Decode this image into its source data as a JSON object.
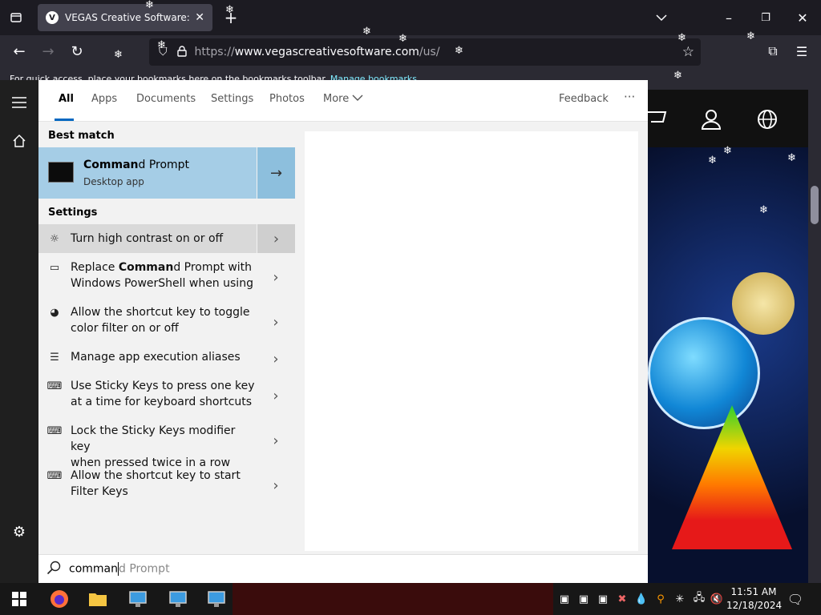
{
  "browser": {
    "tab_title": "VEGAS Creative Software: The c",
    "tab_favicon": "V",
    "url_prefix": "https://",
    "url_host": "www.vegascreativesoftware.com",
    "url_path": "/us/",
    "bookmarks_text": "For quick access, place your bookmarks here on the bookmarks toolbar.",
    "bookmarks_link": "Manage bookmarks…",
    "icons": [
      "tab-list-icon",
      "close-icon",
      "new-tab-icon",
      "list-all-tabs-icon",
      "minimize-icon",
      "restore-icon",
      "back-icon",
      "forward-icon",
      "reload-icon",
      "shield-icon",
      "lock-icon",
      "star-icon",
      "extensions-icon",
      "menu-icon"
    ]
  },
  "search": {
    "filters": [
      {
        "label": "All",
        "active": true
      },
      {
        "label": "Apps"
      },
      {
        "label": "Documents"
      },
      {
        "label": "Settings"
      },
      {
        "label": "Photos"
      },
      {
        "label": "More"
      }
    ],
    "feedback": "Feedback",
    "more_options": "···",
    "best_match_label": "Best match",
    "best_match": {
      "title_bold": "Comman",
      "title_rest": "d Prompt",
      "subtitle": "Desktop app"
    },
    "settings_label": "Settings",
    "settings_results": [
      {
        "icon": "☼",
        "icon_name": "brightness-icon",
        "line1_pre": "Turn high contrast on or off",
        "line1_bold": "",
        "line1_post": "",
        "line2": ""
      },
      {
        "icon": "▭",
        "icon_name": "monitor-icon",
        "line1_pre": "Replace ",
        "line1_bold": "Comman",
        "line1_post": "d Prompt with",
        "line2": "Windows PowerShell when using"
      },
      {
        "icon": "◕",
        "icon_name": "palette-icon",
        "line1_pre": "Allow the shortcut key to toggle",
        "line1_bold": "",
        "line1_post": "",
        "line2": "color filter on or off"
      },
      {
        "icon": "☰",
        "icon_name": "list-icon",
        "line1_pre": "Manage app execution aliases",
        "line1_bold": "",
        "line1_post": "",
        "line2": ""
      },
      {
        "icon": "⌨",
        "icon_name": "keyboard-icon",
        "line1_pre": "Use Sticky Keys to press one key",
        "line1_bold": "",
        "line1_post": "",
        "line2": "at a time for keyboard shortcuts"
      },
      {
        "icon": "⌨",
        "icon_name": "keyboard-icon",
        "line1_pre": "Lock the Sticky Keys modifier key",
        "line1_bold": "",
        "line1_post": "",
        "line2": "when pressed twice in a row"
      },
      {
        "icon": "⌨",
        "icon_name": "keyboard-icon",
        "line1_pre": "Allow the shortcut key to start",
        "line1_bold": "",
        "line1_post": "",
        "line2": "Filter Keys"
      }
    ],
    "query_typed": "comman",
    "query_suggest": "d Prompt"
  },
  "taskbar": {
    "time": "11:51 AM",
    "date": "12/18/2024"
  }
}
